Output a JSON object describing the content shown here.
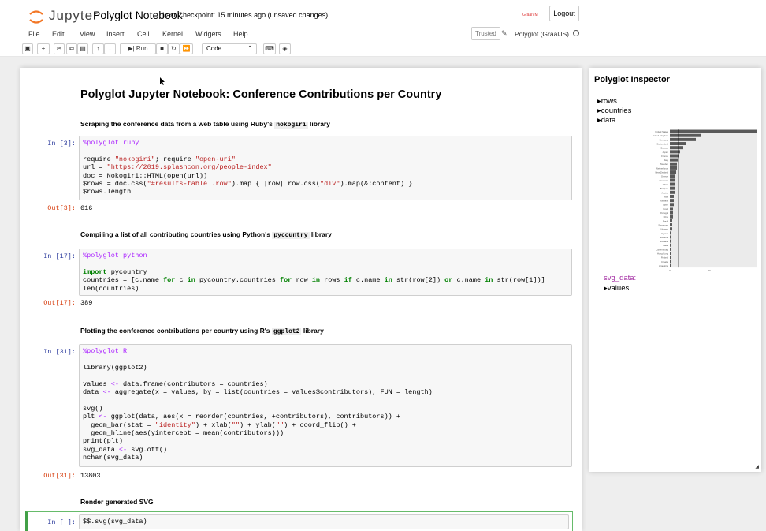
{
  "header": {
    "logo_text": "Jupyter",
    "notebook_title": "Polyglot Notebook",
    "checkpoint": "Last Checkpoint: 15 minutes ago  (unsaved changes)",
    "graal_label": "GraalVM",
    "logout_label": "Logout"
  },
  "menu": {
    "items": [
      "File",
      "Edit",
      "View",
      "Insert",
      "Cell",
      "Kernel",
      "Widgets",
      "Help"
    ],
    "trusted": "Trusted",
    "kernel": "Polyglot (GraalJS)"
  },
  "toolbar": {
    "run_label": "Run",
    "cell_type": "Code"
  },
  "notebook": {
    "heading": "Polyglot Jupyter Notebook: Conference Contributions per Country",
    "md1_pre": "Scraping the conference data from a web table using Ruby's ",
    "md1_code": "nokogiri",
    "md1_post": " library",
    "md2_pre": "Compiling a list of all contributing countries using Python's ",
    "md2_code": "pycountry",
    "md2_post": " library",
    "md3_pre": "Plotting the conference contributions per country using R's ",
    "md3_code": "ggplot2",
    "md3_post": " library",
    "md4": "Render generated SVG",
    "cell1_in": "In [3]:",
    "cell1_out_prompt": "Out[3]:",
    "cell1_out": "616",
    "cell2_in": "In [17]:",
    "cell2_out_prompt": "Out[17]:",
    "cell2_out": "389",
    "cell3_in": "In [31]:",
    "cell3_out_prompt": "Out[31]:",
    "cell3_out": "13803",
    "cell4_in": "In [ ]:",
    "cell1_lines": [
      "%polyglot ruby",
      "",
      "require \"nokogiri\"; require \"open-uri\"",
      "url = \"https://2019.splashcon.org/people-index\"",
      "doc = Nokogiri::HTML(open(url))",
      "$rows = doc.css(\"#results-table .row\").map { |row| row.css(\"div\").map(&:content) }",
      "$rows.length"
    ],
    "cell2_lines": [
      "%polyglot python",
      "",
      "import pycountry",
      "countries = [c.name for c in pycountry.countries for row in rows if c.name in str(row[2]) or c.name in str(row[1])]",
      "len(countries)"
    ],
    "cell3_lines": [
      "%polyglot R",
      "",
      "library(ggplot2)",
      "",
      "values <- data.frame(contributors = countries)",
      "data <- aggregate(x = values, by = list(countries = values$contributors), FUN = length)",
      "",
      "svg()",
      "plt <- ggplot(data, aes(x = reorder(countries, +contributors), contributors)) +",
      "  geom_bar(stat = \"identity\") + xlab(\"\") + ylab(\"\") + coord_flip() +",
      "  geom_hline(aes(yintercept = mean(contributors)))",
      "print(plt)",
      "svg_data <- svg.off()",
      "nchar(svg_data)"
    ],
    "cell4_code": "$$.svg(svg_data)"
  },
  "inspector": {
    "title": "Polyglot Inspector",
    "tree": [
      "▸rows",
      "▸countries",
      "▸data"
    ],
    "svg_label": "svg_data:",
    "values": "▸values"
  },
  "chart_data": {
    "type": "bar",
    "orientation": "horizontal",
    "categories": [
      "United States",
      "United Kingdom",
      "Germany",
      "Switzerland",
      "Canada",
      "Japan",
      "France",
      "Italy",
      "Sweden",
      "Netherlands",
      "New Zealand",
      "Greece",
      "Denmark",
      "China",
      "Belgium",
      "Austria",
      "India",
      "Australia",
      "Spain",
      "Israel",
      "Portugal",
      "Chile",
      "Brazil",
      "Singapore",
      "Norway",
      "Cyprus",
      "Slovenia",
      "Slovakia",
      "Malta",
      "Luxembourg",
      "Hong Kong",
      "Finland",
      "Croatia",
      "Argentina"
    ],
    "values": [
      110,
      40,
      33,
      20,
      17,
      13,
      12,
      10,
      9,
      9,
      8,
      7,
      7,
      7,
      6,
      6,
      5,
      5,
      5,
      4,
      4,
      4,
      3,
      3,
      3,
      2,
      2,
      2,
      1,
      1,
      1,
      1,
      1,
      1
    ],
    "mean": 11,
    "xticks": [
      "0",
      "50"
    ],
    "grid": true
  }
}
